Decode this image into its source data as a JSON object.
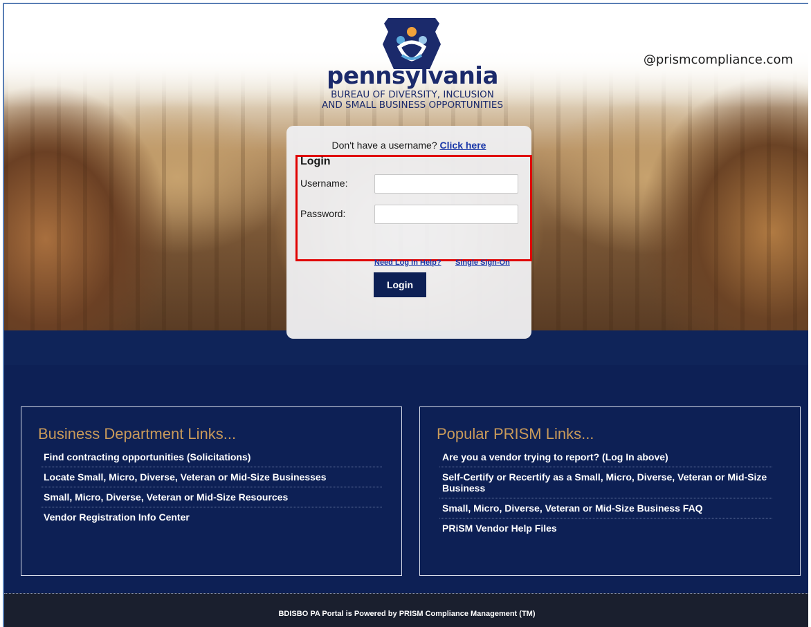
{
  "brand": {
    "name": "pennsylvania",
    "subtitle_line1": "BUREAU OF DIVERSITY, INCLUSION",
    "subtitle_line2": "AND SMALL BUSINESS OPPORTUNITIES",
    "domain": "@prismcompliance.com"
  },
  "login": {
    "signup_prompt": "Don't have a username?",
    "signup_link": "Click here",
    "heading": "Login",
    "username_label": "Username:",
    "username_value": "",
    "password_label": "Password:",
    "password_value": "",
    "help_link": "Need Log In Help?",
    "sso_link": "Single Sign-On",
    "submit_label": "Login"
  },
  "business_links": {
    "title": "Business Department Links...",
    "items": [
      "Find contracting opportunities (Solicitations)",
      "Locate Small, Micro, Diverse, Veteran or Mid-Size Businesses",
      "Small, Micro, Diverse, Veteran or Mid-Size Resources",
      "Vendor Registration Info Center"
    ]
  },
  "prism_links": {
    "title": "Popular PRISM Links...",
    "items": [
      "Are you a vendor trying to report? (Log In above)",
      "Self-Certify or Recertify as a Small, Micro, Diverse, Veteran or Mid-Size Business",
      "Small, Micro, Diverse, Veteran or Mid-Size Business FAQ",
      "PRiSM Vendor Help Files"
    ]
  },
  "footer": {
    "text": "BDISBO PA Portal is Powered by PRISM Compliance Management (TM)"
  },
  "colors": {
    "navy": "#0d2055",
    "link_blue": "#1a37a8",
    "section_title": "#c99a5a",
    "highlight": "#e00000"
  }
}
